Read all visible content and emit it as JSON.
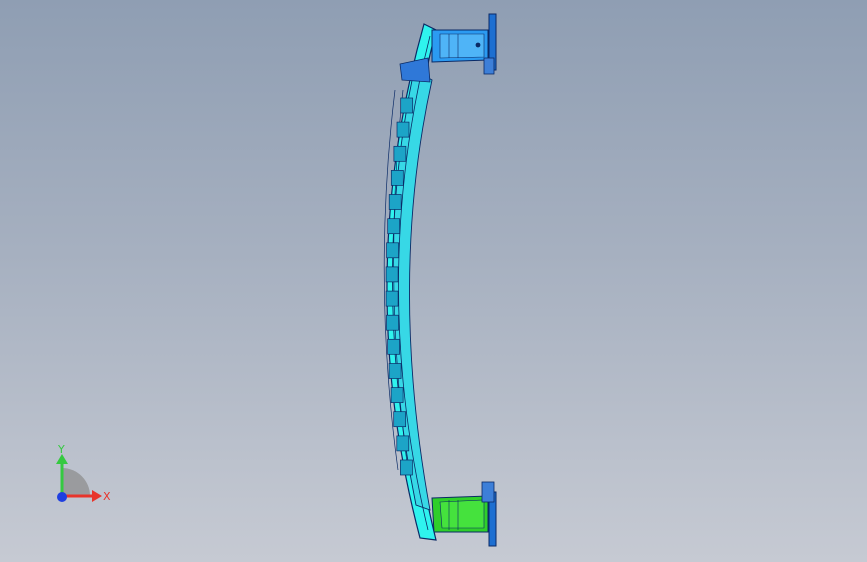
{
  "viewport": {
    "background_top": "#8f9eb3",
    "background_bottom": "#c6cad3"
  },
  "model": {
    "beam_color": "#2ff3ee",
    "beam_edge_color": "#0a2a66",
    "top_bracket_color": "#2b9bf2",
    "bottom_bracket_color": "#2fcf2a",
    "pocket_color": "#1ca4c7"
  },
  "triad": {
    "x_label": "X",
    "y_label": "Y",
    "x_color": "#e8342b",
    "y_color": "#35c940",
    "z_color": "#1f3fe0"
  }
}
